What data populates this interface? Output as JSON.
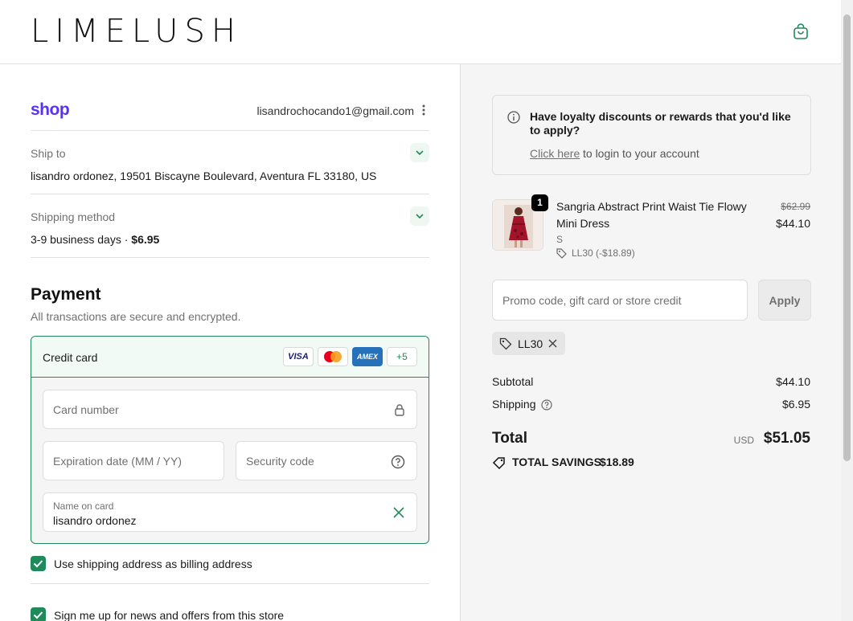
{
  "header": {
    "logo_text": "LIMELUSH",
    "cart_icon": "shopping-bag-icon"
  },
  "account": {
    "shop_label": "shop",
    "email": "lisandrochocando1@gmail.com"
  },
  "ship_to": {
    "label": "Ship to",
    "value": "lisandro ordonez, 19501 Biscayne Boulevard, Aventura FL 33180, US"
  },
  "shipping_method": {
    "label": "Shipping method",
    "value": "3-9 business days · ",
    "price": "$6.95"
  },
  "payment": {
    "title": "Payment",
    "subtitle": "All transactions are secure and encrypted.",
    "method_label": "Credit card",
    "brands": [
      "VISA",
      "MC",
      "AMEX",
      "+5"
    ],
    "card_number_placeholder": "Card number",
    "expiration_placeholder": "Expiration date (MM / YY)",
    "security_placeholder": "Security code",
    "name_label": "Name on card",
    "name_value": "lisandro ordonez"
  },
  "options": {
    "billing_same": "Use shipping address as billing address",
    "newsletter": "Sign me up for news and offers from this store"
  },
  "loyalty": {
    "title": "Have loyalty discounts or rewards that you'd like to apply?",
    "link": "Click here",
    "rest": "to login to your account"
  },
  "item": {
    "quantity": "1",
    "name": "Sangria Abstract Print Waist Tie Flowy Mini Dress",
    "size": "S",
    "discount": "LL30 (-$18.89)",
    "price_original": "$62.99",
    "price_final": "$44.10"
  },
  "promo": {
    "placeholder": "Promo code, gift card or store credit",
    "apply_label": "Apply",
    "applied_code": "LL30"
  },
  "summary": {
    "subtotal_label": "Subtotal",
    "subtotal_value": "$44.10",
    "shipping_label": "Shipping",
    "shipping_value": "$6.95",
    "total_label": "Total",
    "currency": "USD",
    "total_value": "$51.05",
    "savings_label": "TOTAL SAVINGS",
    "savings_value": "$18.89"
  },
  "colors": {
    "accent": "#1f8a5a",
    "shop_purple": "#5a31f4"
  }
}
